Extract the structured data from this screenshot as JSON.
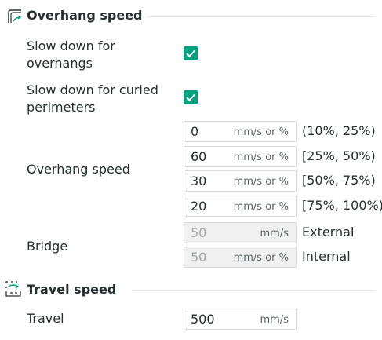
{
  "overhang_section": {
    "title": "Overhang speed",
    "icon": "overhang-speed-icon"
  },
  "slow_down_overhangs": {
    "label_line1": "Slow down for",
    "label_line2": "overhangs",
    "checked": true
  },
  "slow_down_curled": {
    "label_line1": "Slow down for curled",
    "label_line2": "perimeters",
    "checked": true
  },
  "overhang_speed": {
    "label": "Overhang speed",
    "rows": [
      {
        "value": "0",
        "unit": "mm/s or %",
        "range": "(10%, 25%)"
      },
      {
        "value": "60",
        "unit": "mm/s or %",
        "range": "[25%, 50%)"
      },
      {
        "value": "30",
        "unit": "mm/s or %",
        "range": "[50%, 75%)"
      },
      {
        "value": "20",
        "unit": "mm/s or %",
        "range": "[75%, 100%)"
      }
    ]
  },
  "bridge": {
    "label": "Bridge",
    "external": {
      "value": "50",
      "unit": "mm/s",
      "side_label": "External"
    },
    "internal": {
      "value": "50",
      "unit": "mm/s or %",
      "side_label": "Internal"
    }
  },
  "travel_section": {
    "title": "Travel speed",
    "icon": "travel-speed-icon"
  },
  "travel": {
    "label": "Travel",
    "value": "500",
    "unit": "mm/s"
  },
  "colors": {
    "accent": "#00a27d",
    "text": "#262e30",
    "divider": "#e4e6e7"
  }
}
